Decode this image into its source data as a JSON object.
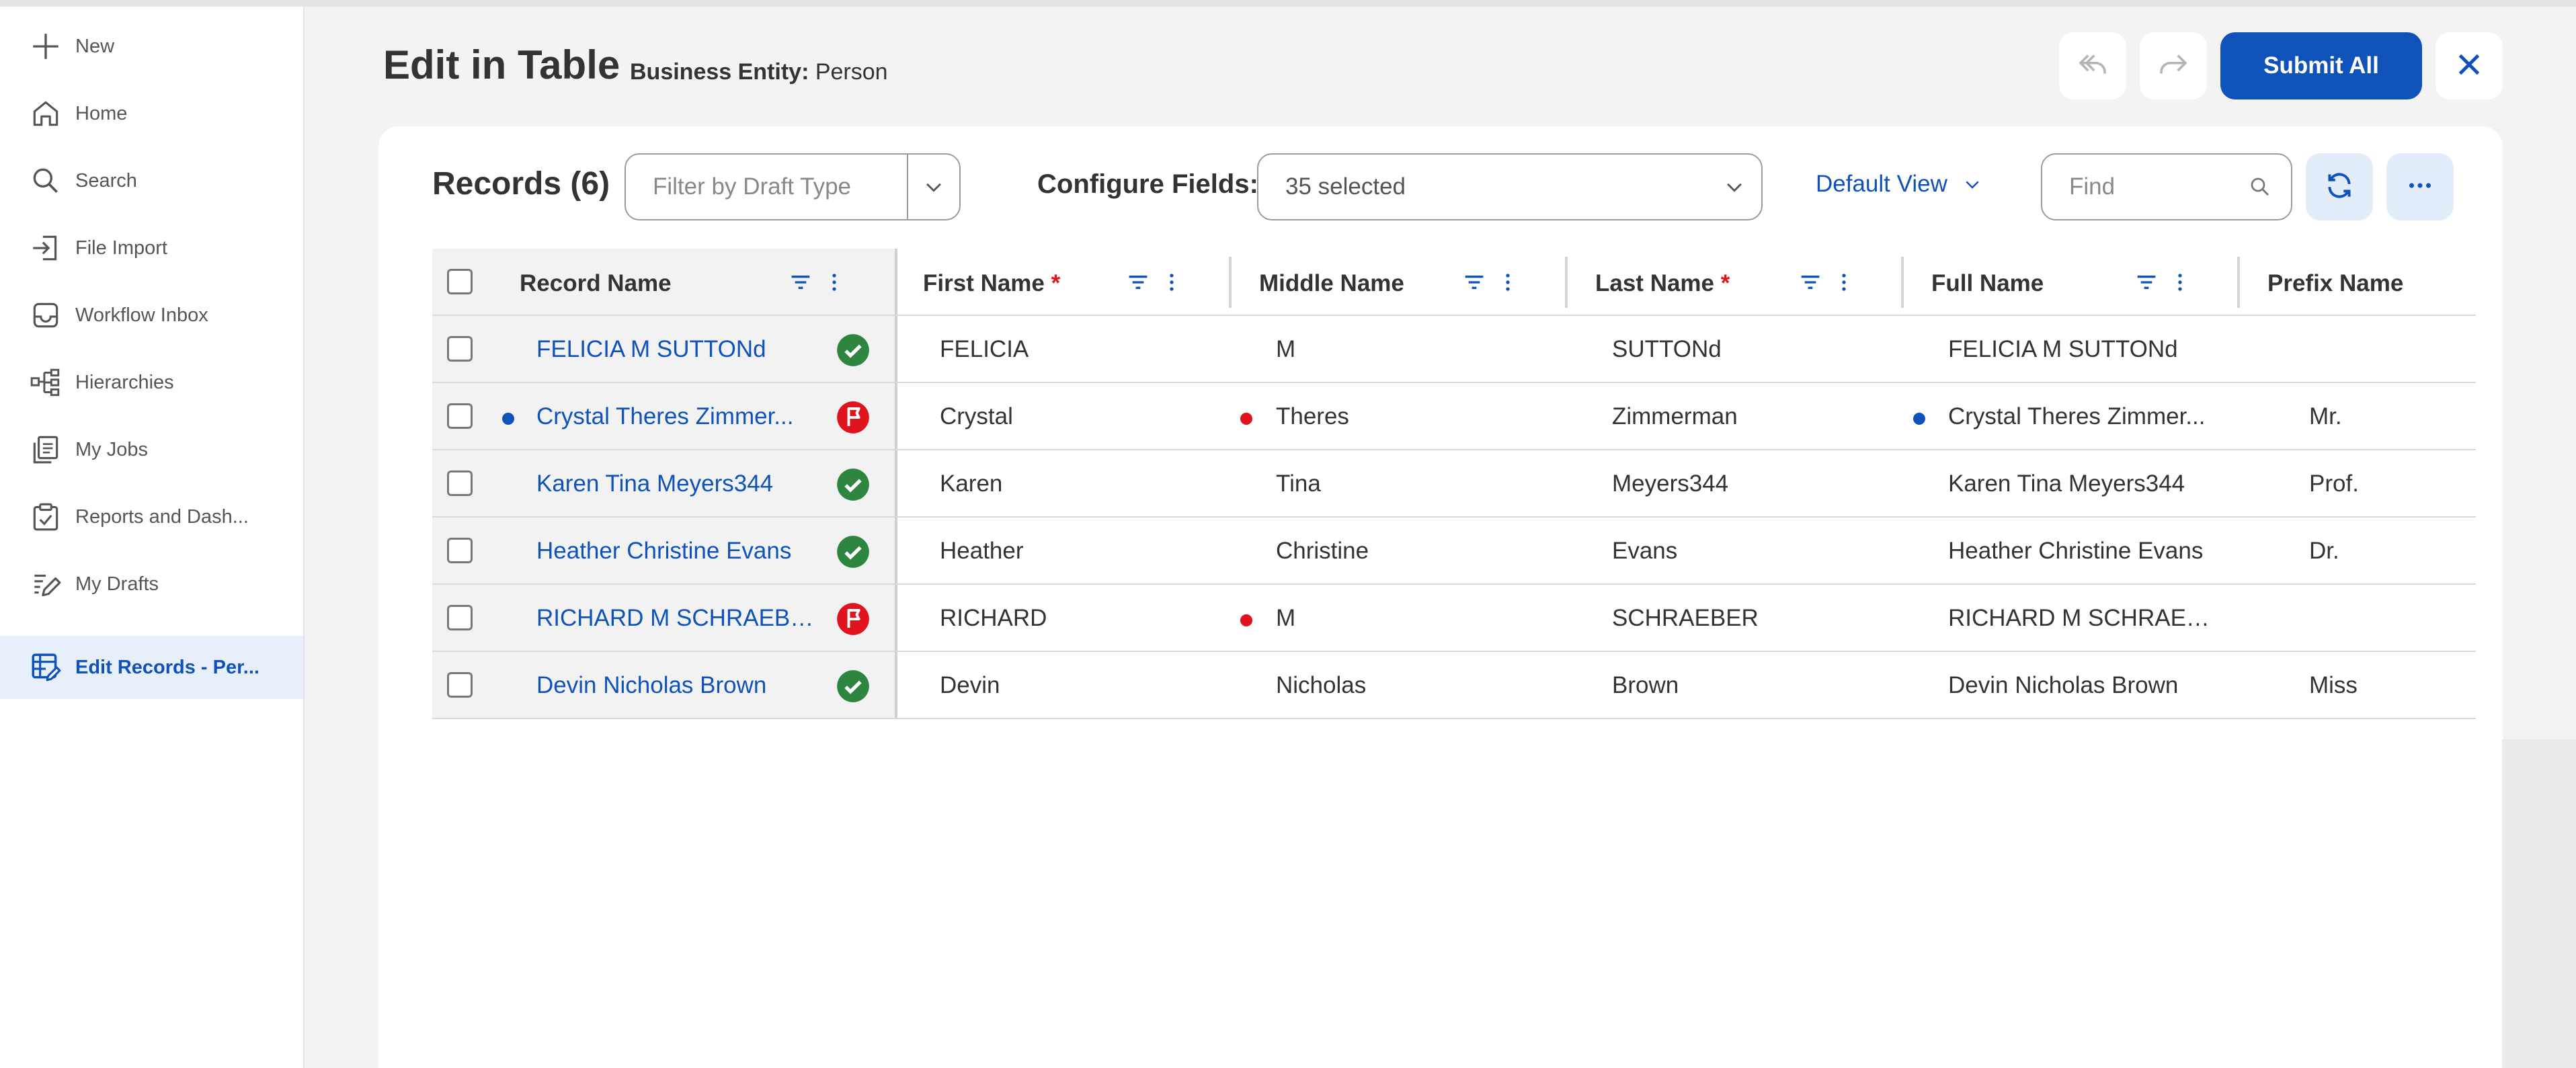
{
  "sidebar": {
    "items": [
      {
        "label": "New",
        "icon": "plus-icon"
      },
      {
        "label": "Home",
        "icon": "home-icon"
      },
      {
        "label": "Search",
        "icon": "search-icon"
      },
      {
        "label": "File Import",
        "icon": "file-import-icon"
      },
      {
        "label": "Workflow Inbox",
        "icon": "inbox-icon"
      },
      {
        "label": "Hierarchies",
        "icon": "hierarchy-icon"
      },
      {
        "label": "My Jobs",
        "icon": "jobs-icon"
      },
      {
        "label": "Reports and Dash...",
        "icon": "reports-icon"
      },
      {
        "label": "My Drafts",
        "icon": "drafts-icon"
      },
      {
        "label": "Edit Records - Per...",
        "icon": "edit-table-icon",
        "active": true
      }
    ]
  },
  "header": {
    "title": "Edit in Table",
    "entity_label": "Business Entity:",
    "entity_value": "Person",
    "submit_label": "Submit All"
  },
  "toolbar": {
    "records_label": "Records (6)",
    "draft_filter_placeholder": "Filter by Draft Type",
    "configure_label": "Configure Fields:",
    "configure_value": "35 selected",
    "view_label": "Default View",
    "find_placeholder": "Find"
  },
  "table": {
    "columns": {
      "record_name": "Record Name",
      "first_name": "First Name",
      "middle_name": "Middle Name",
      "last_name": "Last Name",
      "full_name": "Full Name",
      "prefix_name": "Prefix Name",
      "required_mark": "*"
    },
    "rows": [
      {
        "record_name": "FELICIA M SUTTONd",
        "status": "valid",
        "first_name": "FELICIA",
        "middle_name": "M",
        "last_name": "SUTTONd",
        "full_name": "FELICIA M SUTTONd",
        "prefix_name": ""
      },
      {
        "record_name": "Crystal Theres Zimmer...",
        "status": "error",
        "first_name": "Crystal",
        "middle_name": "Theres",
        "last_name": "Zimmerman",
        "full_name": "Crystal Theres Zimmer...",
        "prefix_name": "Mr."
      },
      {
        "record_name": "Karen Tina Meyers344",
        "status": "valid",
        "first_name": "Karen",
        "middle_name": "Tina",
        "last_name": "Meyers344",
        "full_name": "Karen Tina Meyers344",
        "prefix_name": "Prof."
      },
      {
        "record_name": "Heather Christine Evans",
        "status": "valid",
        "first_name": "Heather",
        "middle_name": "Christine",
        "last_name": "Evans",
        "full_name": "Heather Christine Evans",
        "prefix_name": "Dr."
      },
      {
        "record_name": "RICHARD M SCHRAEBER",
        "status": "error",
        "first_name": "RICHARD",
        "middle_name": "M",
        "last_name": "SCHRAEBER",
        "full_name": "RICHARD M SCHRAEB...",
        "prefix_name": ""
      },
      {
        "record_name": "Devin Nicholas Brown",
        "status": "valid",
        "first_name": "Devin",
        "middle_name": "Nicholas",
        "last_name": "Brown",
        "full_name": "Devin Nicholas Brown",
        "prefix_name": "Miss"
      }
    ]
  },
  "colors": {
    "accent": "#0f52ba",
    "valid": "#2e8540",
    "error": "#e0141e"
  }
}
